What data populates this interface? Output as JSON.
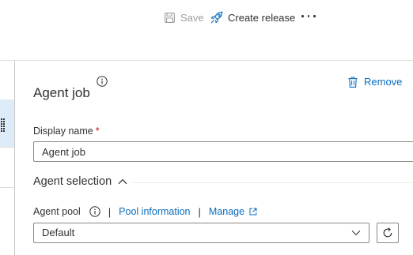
{
  "toolbar": {
    "save_label": "Save",
    "create_release_label": "Create release",
    "save_icon": "floppy-disk-icon",
    "create_release_icon": "rocket-icon",
    "more_icon": "more-horizontal-icon"
  },
  "agent_job": {
    "title": "Agent job",
    "remove_label": "Remove",
    "remove_icon": "trash-icon",
    "display_name": {
      "label": "Display name",
      "required_marker": "*",
      "value": "Agent job"
    },
    "agent_selection": {
      "title": "Agent selection",
      "expanded": true,
      "agent_pool_label": "Agent pool",
      "separator": "|",
      "pool_information_link": "Pool information",
      "manage_link": "Manage",
      "selected_pool": "Default"
    }
  },
  "colors": {
    "link": "#0b6cbd",
    "required": "#c50f1f",
    "selected_background": "#deecf9",
    "disabled_text": "#a19f9d",
    "border": "#8a8886"
  }
}
